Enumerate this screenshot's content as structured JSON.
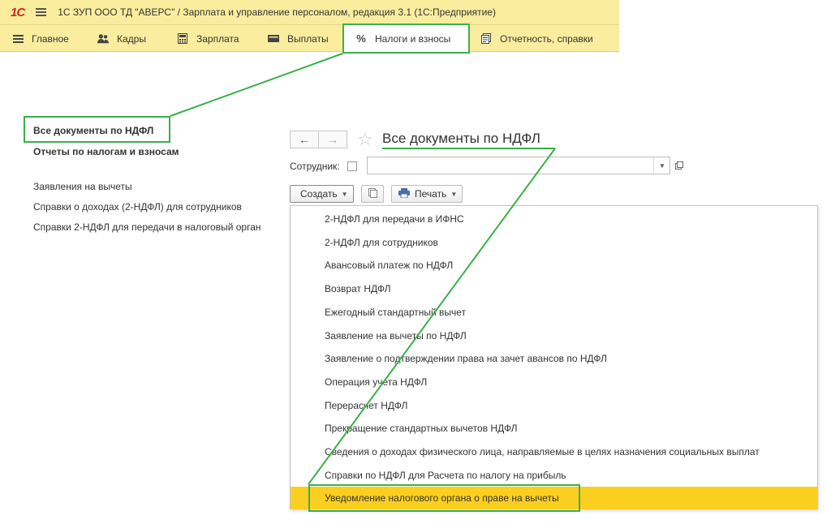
{
  "titlebar": {
    "logo": "1С",
    "title": "1С ЗУП ООО ТД \"АВЕРС\" / Зарплата и управление персоналом, редакция 3.1  (1С:Предприятие)"
  },
  "sections": [
    {
      "label": "Главное",
      "icon": "list-icon"
    },
    {
      "label": "Кадры",
      "icon": "people-icon"
    },
    {
      "label": "Зарплата",
      "icon": "calculator-icon"
    },
    {
      "label": "Выплаты",
      "icon": "wallet-icon"
    },
    {
      "label": "Налоги и взносы",
      "icon": "percent-icon"
    },
    {
      "label": "Отчетность, справки",
      "icon": "reports-icon"
    }
  ],
  "left_panel": {
    "all_docs": "Все документы по НДФЛ",
    "reports": "Отчеты по налогам и взносам",
    "deductions": "Заявления на вычеты",
    "income_certs": "Справки о доходах (2-НДФЛ) для сотрудников",
    "tax_certs": "Справки 2-НДФЛ для передачи в налоговый орган"
  },
  "document": {
    "title": "Все документы по НДФЛ",
    "back_glyph": "←",
    "forward_glyph": "→",
    "star_glyph": "☆",
    "employee_label": "Сотрудник:",
    "employee_value": "",
    "create_label": "Создать",
    "print_label": "Печать"
  },
  "create_menu": {
    "items": [
      "2-НДФЛ для передачи в ИФНС",
      "2-НДФЛ для сотрудников",
      "Авансовый платеж по НДФЛ",
      "Возврат НДФЛ",
      "Ежегодный стандартный вычет",
      "Заявление на вычеты по НДФЛ",
      "Заявление о подтверждении права на зачет авансов по НДФЛ",
      "Операция учета НДФЛ",
      "Перерасчет НДФЛ",
      "Прекращение стандартных вычетов НДФЛ",
      "Сведения о доходах физического лица, направляемые в целях назначения социальных выплат",
      "Справки по НДФЛ для Расчета по налогу на прибыль",
      "Уведомление налогового органа о праве на вычеты"
    ],
    "selected_index": 12
  },
  "colors": {
    "section_bg": "#fbed9e",
    "highlight": "#3ab04a",
    "selected_row": "#fbcf1f"
  }
}
